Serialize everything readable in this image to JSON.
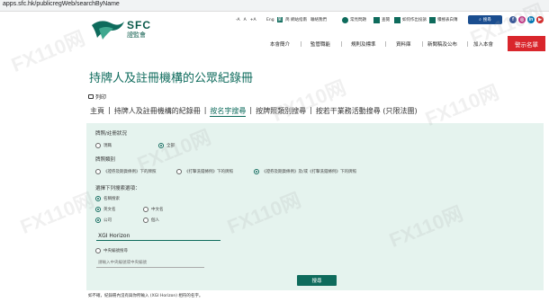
{
  "browser": {
    "url": "apps.sfc.hk/publicregWeb/searchByName"
  },
  "logo": {
    "title": "SFC",
    "subtitle": "證監會"
  },
  "utility": {
    "font_controls": [
      "-A",
      "A",
      "+A"
    ],
    "language": [
      "Eng",
      "繁",
      "简"
    ],
    "links": [
      "網站指南",
      "聯絡我們"
    ],
    "pills": [
      "常見問題",
      "查閱",
      "如何作出投訴",
      "積極表白簿"
    ],
    "search_label": "搜尋"
  },
  "social": [
    {
      "icon": "facebook-icon",
      "glyph": "f",
      "color": "#3b5998"
    },
    {
      "icon": "instagram-icon",
      "glyph": "◎",
      "color": "#c13584"
    },
    {
      "icon": "linkedin-icon",
      "glyph": "in",
      "color": "#0077b5"
    },
    {
      "icon": "youtube-icon",
      "glyph": "▶",
      "color": "#d32f2f"
    }
  ],
  "nav": {
    "items": [
      "本會簡介",
      "監管職能",
      "規則及標準",
      "資料庫",
      "新聞稿及公布",
      "加入本會"
    ],
    "alert": "警示名單"
  },
  "page_title": "持牌人及註冊機構的公眾紀錄冊",
  "print_label": "列印",
  "breadcrumb": {
    "items": [
      "主頁",
      "持牌人及註冊機構的紀錄冊",
      "按名字搜尋",
      "按牌照類別搜尋",
      "按若干業務活動搜尋 (只限法團)"
    ],
    "separator": "|"
  },
  "form": {
    "status": {
      "label": "牌照/註冊狀況",
      "options": [
        "現職",
        "全部"
      ],
      "selected": 1
    },
    "licence_type": {
      "label": "牌照類別",
      "options": [
        "《證券及期貨條例》下的牌照",
        "《打擊洗錢條例》下的牌照",
        "《證券及期貨條例》及/或《打擊洗錢條例》下的牌照"
      ],
      "selected": 2
    },
    "choose_label": "選擇下列搜索選項：",
    "by_name": "名稱搜索",
    "english": "英文名",
    "chinese": "中文名",
    "corporation": "公司",
    "individual": "個人",
    "name_value": "XGI Horizon",
    "by_ce": "中央編號搜尋",
    "ce_placeholder": "請輸入中央編號或中央編號",
    "submit": "搜尋"
  },
  "footnote": "如不確，紀錄冊內沒有與你所輸入 (XGI Horizon) 相符的名字。",
  "watermark": "FX110网",
  "colors": {
    "brand": "#0e6b5c",
    "alert": "#d9262c",
    "panel": "#e5f3ee",
    "search_btn": "#1a4d8f"
  }
}
